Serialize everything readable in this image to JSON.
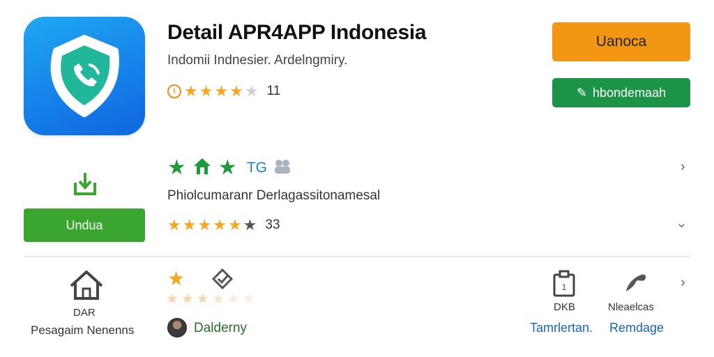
{
  "app": {
    "title": "Detail APR4APP Indonesia",
    "subtitle": "Indomii Indnesier. Ardelngmiry.",
    "rating_count": "11",
    "rating_stars": 4
  },
  "buttons": {
    "primary_label": "Uanoca",
    "secondary_label": "hbondemaah",
    "download_label": "Undua"
  },
  "badges_row": {
    "tag": "TG",
    "description": "Phiolcumaranr Derlagassitonamesal",
    "rating_count": "33",
    "rating_stars": 5
  },
  "bottom": {
    "home_label_1": "DAR",
    "home_label_2": "Pesagaim Nenenns",
    "developer": "Dalderny",
    "item1_label": "DKB",
    "item2_label": "Nleaelcas",
    "link1": "Tamrlertan.",
    "link2": "Remdage"
  },
  "colors": {
    "accent_orange": "#f39614",
    "accent_green": "#1b9447",
    "download_green": "#3aa62f",
    "link_blue": "#1565c0",
    "icon_blue": "#1682ea"
  }
}
